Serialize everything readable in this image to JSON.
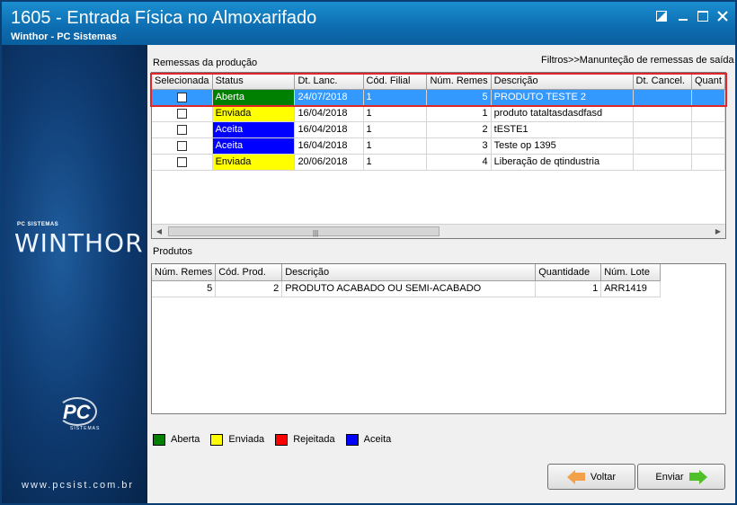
{
  "window": {
    "title": "1605 - Entrada Física no Almoxarifado",
    "subtitle": "Winthor - PC Sistemas",
    "controls": [
      "restore-icon",
      "minimize-icon",
      "maximize-icon",
      "close-icon"
    ]
  },
  "sidebar": {
    "brand_small": "PC SISTEMAS",
    "brand": "WINTHOR",
    "pc_logo": "PC",
    "pc_sub": "SISTEMAS",
    "website": "www.pcsist.com.br"
  },
  "remessas": {
    "label": "Remessas da produção",
    "filter_link": "Filtros>>Manunteção de remessas de saída",
    "columns": [
      "Selecionada",
      "Status",
      "Dt. Lanc.",
      "Cód. Filial",
      "Núm. Remes",
      "Descrição",
      "Dt. Cancel.",
      "Quant"
    ],
    "rows": [
      {
        "status": "Aberta",
        "status_color": "#008000",
        "dt_lanc": "24/07/2018",
        "filial": "1",
        "num": "5",
        "descricao": "PRODUTO TESTE 2",
        "selected": true
      },
      {
        "status": "Enviada",
        "status_color": "#ffff00",
        "dt_lanc": "16/04/2018",
        "filial": "1",
        "num": "1",
        "descricao": "produto tataltasdasdfasd",
        "selected": false
      },
      {
        "status": "Aceita",
        "status_color": "#0000ff",
        "dt_lanc": "16/04/2018",
        "filial": "1",
        "num": "2",
        "descricao": "tESTE1",
        "selected": false
      },
      {
        "status": "Aceita",
        "status_color": "#0000ff",
        "dt_lanc": "16/04/2018",
        "filial": "1",
        "num": "3",
        "descricao": "Teste op 1395",
        "selected": false
      },
      {
        "status": "Enviada",
        "status_color": "#ffff00",
        "dt_lanc": "20/06/2018",
        "filial": "1",
        "num": "4",
        "descricao": "Liberação de qtindustria",
        "selected": false
      }
    ]
  },
  "produtos": {
    "label": "Produtos",
    "columns": [
      "Núm. Remes",
      "Cód. Prod.",
      "Descrição",
      "Quantidade",
      "Núm. Lote"
    ],
    "rows": [
      {
        "num": "5",
        "cod": "2",
        "descricao": "PRODUTO ACABADO OU SEMI-ACABADO",
        "quantidade": "1",
        "lote": "ARR1419"
      }
    ]
  },
  "legend": [
    {
      "label": "Aberta",
      "color": "#008000"
    },
    {
      "label": "Enviada",
      "color": "#ffff00"
    },
    {
      "label": "Rejeitada",
      "color": "#ff0000"
    },
    {
      "label": "Aceita",
      "color": "#0000ff"
    }
  ],
  "buttons": {
    "voltar": "Voltar",
    "enviar": "Enviar"
  }
}
